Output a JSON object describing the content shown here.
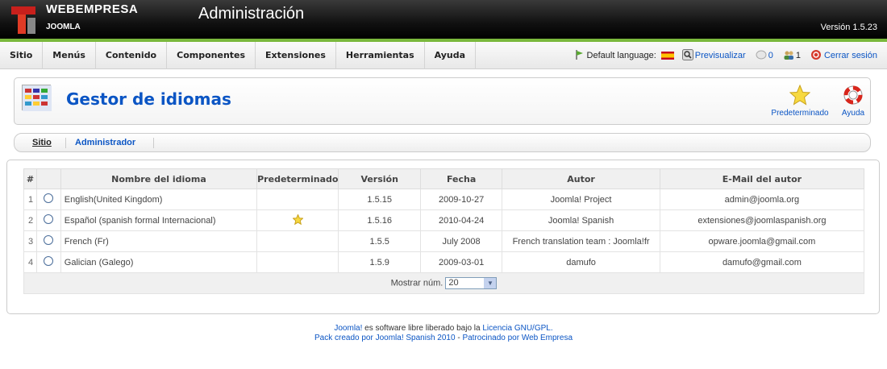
{
  "header": {
    "brand": "WEBEMPRESA",
    "brand_sub": "JOOMLA",
    "title": "Administración",
    "version": "Versión 1.5.23"
  },
  "menu": [
    "Sitio",
    "Menús",
    "Contenido",
    "Componentes",
    "Extensiones",
    "Herramientas",
    "Ayuda"
  ],
  "status": {
    "default_language": "Default language:",
    "preview": "Previsualizar",
    "messages": "0",
    "users": "1",
    "logout": "Cerrar sesión"
  },
  "toolbar": {
    "page_title": "Gestor de idiomas",
    "default_label": "Predeterminado",
    "help_label": "Ayuda"
  },
  "submenu": {
    "sitio": "Sitio",
    "admin": "Administrador"
  },
  "table": {
    "headers": [
      "#",
      "",
      "Nombre del idioma",
      "Predeterminado",
      "Versión",
      "Fecha",
      "Autor",
      "E-Mail del autor"
    ],
    "rows": [
      {
        "num": "1",
        "name": "English(United Kingdom)",
        "default": false,
        "version": "1.5.15",
        "date": "2009-10-27",
        "author": "Joomla! Project",
        "email": "admin@joomla.org"
      },
      {
        "num": "2",
        "name": "Español (spanish formal Internacional)",
        "default": true,
        "version": "1.5.16",
        "date": "2010-04-24",
        "author": "Joomla! Spanish",
        "email": "extensiones@joomlaspanish.org"
      },
      {
        "num": "3",
        "name": "French (Fr)",
        "default": false,
        "version": "1.5.5",
        "date": "July 2008",
        "author": "French translation team : Joomla!fr",
        "email": "opware.joomla@gmail.com"
      },
      {
        "num": "4",
        "name": "Galician (Galego)",
        "default": false,
        "version": "1.5.9",
        "date": "2009-03-01",
        "author": "damufo",
        "email": "damufo@gmail.com"
      }
    ],
    "show_num_label": "Mostrar núm.",
    "show_num_value": "20"
  },
  "footer": {
    "joomla": "Joomla!",
    "line1_text": "es software libre liberado bajo la",
    "license": "Licencia GNU/GPL.",
    "pack": "Pack creado por Joomla! Spanish 2010",
    "dash": "-",
    "sponsor": "Patrocinado por Web Empresa"
  },
  "colors": {
    "link": "#0b55c4",
    "green_line": "#7ab83c",
    "header_bg": "#000000"
  }
}
